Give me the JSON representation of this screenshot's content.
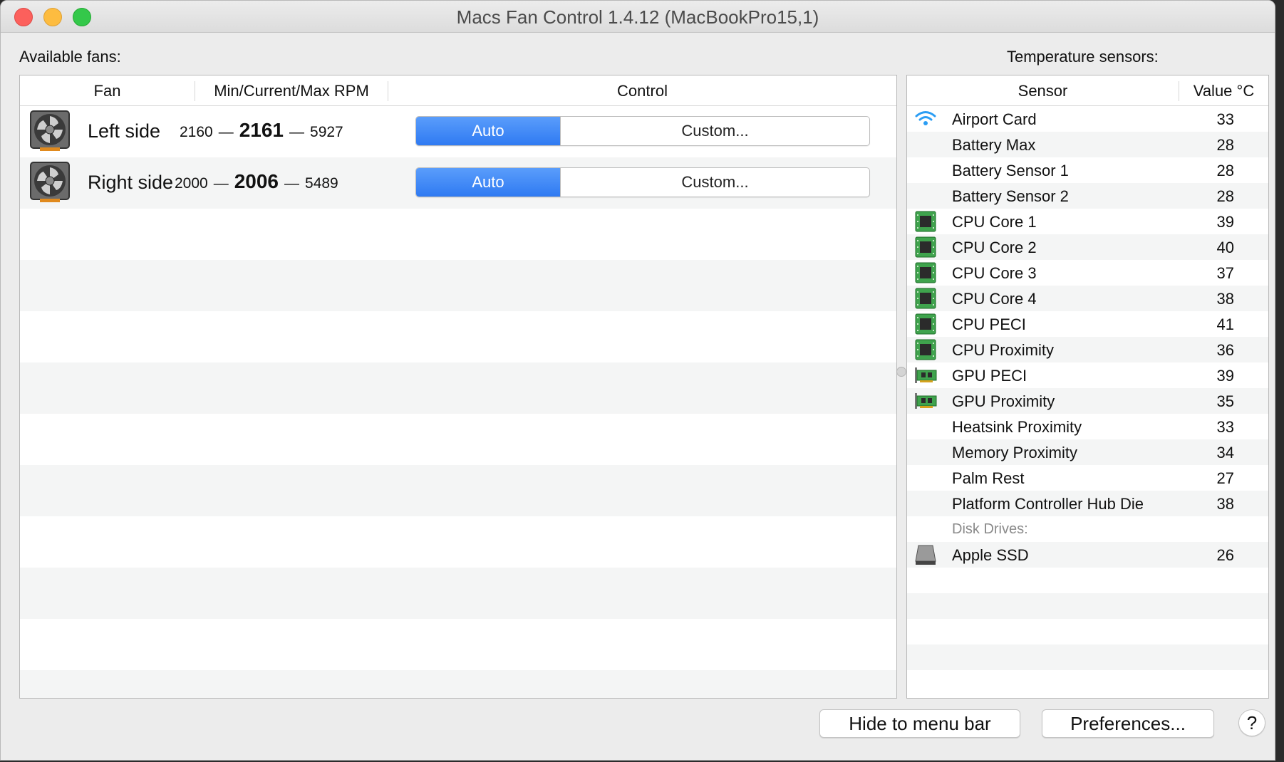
{
  "window": {
    "title": "Macs Fan Control 1.4.12 (MacBookPro15,1)"
  },
  "fans": {
    "section_label": "Available fans:",
    "columns": {
      "fan": "Fan",
      "rpm": "Min/Current/Max RPM",
      "control": "Control"
    },
    "rows": [
      {
        "name": "Left side",
        "min": "2160",
        "current": "2161",
        "max": "5927",
        "auto_label": "Auto",
        "custom_label": "Custom...",
        "icon": "fan-icon"
      },
      {
        "name": "Right side",
        "min": "2000",
        "current": "2006",
        "max": "5489",
        "auto_label": "Auto",
        "custom_label": "Custom...",
        "icon": "fan-icon"
      }
    ],
    "dash": "—"
  },
  "sensors": {
    "section_label": "Temperature sensors:",
    "columns": {
      "sensor": "Sensor",
      "value": "Value °C"
    },
    "rows": [
      {
        "name": "Airport Card",
        "value": "33",
        "icon": "wifi-icon"
      },
      {
        "name": "Battery Max",
        "value": "28",
        "icon": ""
      },
      {
        "name": "Battery Sensor 1",
        "value": "28",
        "icon": ""
      },
      {
        "name": "Battery Sensor 2",
        "value": "28",
        "icon": ""
      },
      {
        "name": "CPU Core 1",
        "value": "39",
        "icon": "cpu-chip-icon"
      },
      {
        "name": "CPU Core 2",
        "value": "40",
        "icon": "cpu-chip-icon"
      },
      {
        "name": "CPU Core 3",
        "value": "37",
        "icon": "cpu-chip-icon"
      },
      {
        "name": "CPU Core 4",
        "value": "38",
        "icon": "cpu-chip-icon"
      },
      {
        "name": "CPU PECI",
        "value": "41",
        "icon": "cpu-chip-icon"
      },
      {
        "name": "CPU Proximity",
        "value": "36",
        "icon": "cpu-chip-icon"
      },
      {
        "name": "GPU PECI",
        "value": "39",
        "icon": "gpu-card-icon"
      },
      {
        "name": "GPU Proximity",
        "value": "35",
        "icon": "gpu-card-icon"
      },
      {
        "name": "Heatsink Proximity",
        "value": "33",
        "icon": ""
      },
      {
        "name": "Memory Proximity",
        "value": "34",
        "icon": ""
      },
      {
        "name": "Palm Rest",
        "value": "27",
        "icon": ""
      },
      {
        "name": "Platform Controller Hub Die",
        "value": "38",
        "icon": ""
      }
    ],
    "disk_header": "Disk Drives:",
    "disk_rows": [
      {
        "name": "Apple SSD",
        "value": "26",
        "icon": "ssd-drive-icon"
      }
    ]
  },
  "buttons": {
    "hide": "Hide to menu bar",
    "preferences": "Preferences...",
    "help": "?"
  }
}
